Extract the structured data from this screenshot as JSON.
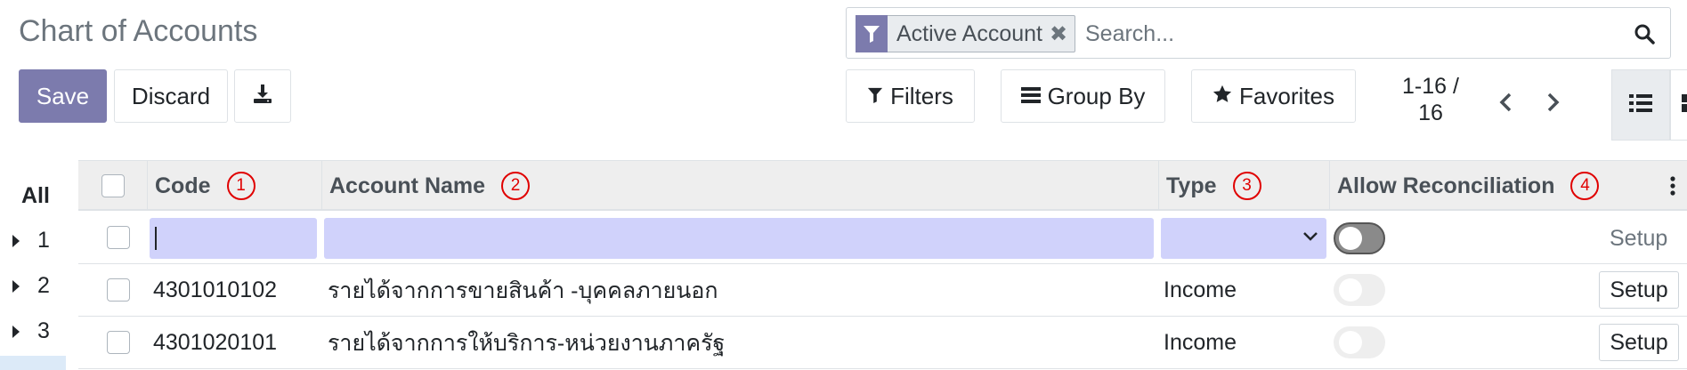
{
  "page": {
    "title": "Chart of Accounts"
  },
  "toolbar": {
    "save_label": "Save",
    "discard_label": "Discard",
    "download_icon": "download-icon"
  },
  "search": {
    "facet_icon": "filter-icon",
    "facet_label": "Active Account",
    "placeholder": "Search...",
    "search_icon": "search-icon"
  },
  "filters": {
    "filters_label": "Filters",
    "groupby_label": "Group By",
    "favorites_label": "Favorites"
  },
  "pager": {
    "value": "1-16 /",
    "total": "16"
  },
  "views": {
    "active": "list"
  },
  "search_panel": {
    "all_label": "All",
    "items": [
      "1",
      "2",
      "3"
    ]
  },
  "table": {
    "columns": [
      {
        "label": "Code",
        "badge": "1"
      },
      {
        "label": "Account Name",
        "badge": "2"
      },
      {
        "label": "Type",
        "badge": "3"
      },
      {
        "label": "Allow Reconciliation",
        "badge": "4"
      }
    ],
    "edit_row": {
      "setup_label": "Setup",
      "reconcile": true
    },
    "rows": [
      {
        "code": "4301010102",
        "name": "รายได้จากการขายสินค้า -บุคคลภายนอก",
        "type": "Income",
        "reconcile": false,
        "setup_label": "Setup"
      },
      {
        "code": "4301020101",
        "name": "รายได้จากการให้บริการ-หน่วยงานภาครัฐ",
        "type": "Income",
        "reconcile": false,
        "setup_label": "Setup"
      }
    ]
  },
  "colors": {
    "primary": "#7c7bad",
    "annotation": "#e00000",
    "edit_field": "#d0d2fb"
  }
}
